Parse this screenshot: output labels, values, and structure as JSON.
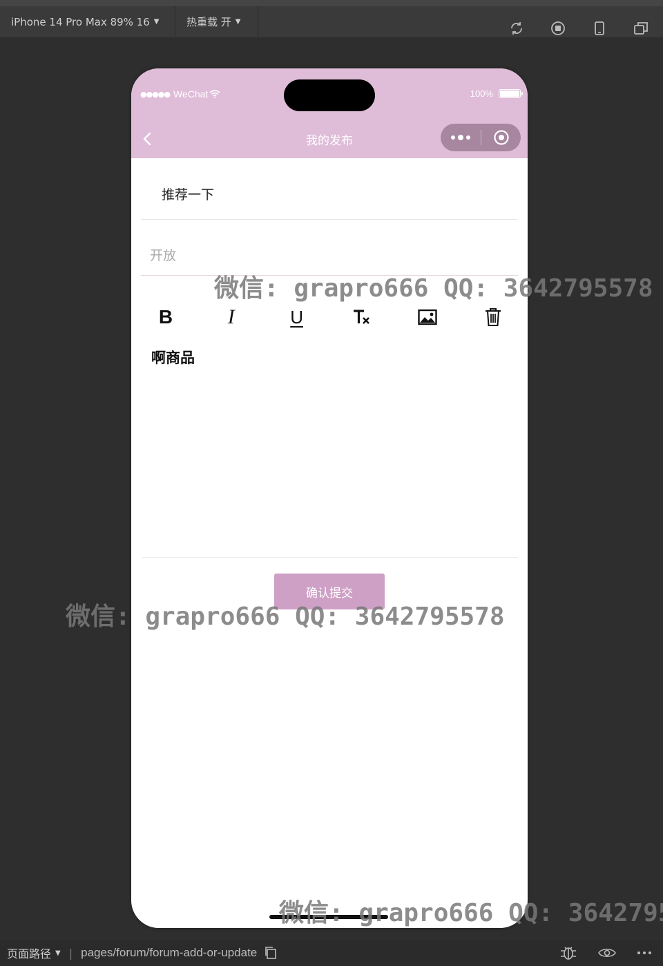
{
  "simulator": {
    "device_label": "iPhone 14 Pro Max 89% 16",
    "hot_reload_label": "热重载 开",
    "tools": [
      "refresh-icon",
      "record-icon",
      "phone-icon",
      "multi-window-icon"
    ]
  },
  "status_bar": {
    "carrier": "WeChat",
    "battery": "100%"
  },
  "nav": {
    "title": "我的发布"
  },
  "form": {
    "title_value": "推荐一下",
    "type_placeholder": "开放",
    "toolbar": {
      "bold": "B",
      "italic": "I",
      "underline": "U",
      "clear_format": "Tx",
      "image": "image-icon",
      "delete": "trash-icon"
    },
    "editor_content": "啊商品",
    "submit_label": "确认提交"
  },
  "bottom_bar": {
    "path_label": "页面路径",
    "path_value": "pages/forum/forum-add-or-update"
  },
  "watermarks": [
    "微信: grapro666 QQ: 3642795578",
    "微信: grapro666 QQ: 3642795578",
    "微信: grapro666 QQ: 3642795"
  ]
}
